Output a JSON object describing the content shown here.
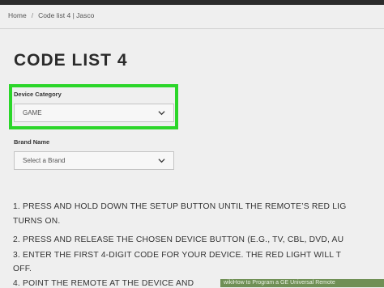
{
  "breadcrumb": {
    "home": "Home",
    "separator": "/",
    "current": "Code list 4 | Jasco"
  },
  "page_title": "CODE LIST 4",
  "device_category": {
    "label": "Device Category",
    "value": "GAME",
    "icon": "chevron-down-icon"
  },
  "brand": {
    "label": "Brand Name",
    "placeholder": "Select a Brand",
    "icon": "chevron-down-icon"
  },
  "steps": [
    "1. PRESS AND HOLD DOWN THE SETUP BUTTON UNTIL THE REMOTE’S RED LIG",
    "TURNS ON.",
    "2. PRESS AND RELEASE THE CHOSEN DEVICE BUTTON (E.G., TV, CBL, DVD, AU",
    "3. ENTER THE FIRST 4-DIGIT CODE FOR YOUR DEVICE. THE RED LIGHT WILL T",
    "OFF.",
    "4. POINT THE REMOTE AT THE DEVICE AND"
  ],
  "footer_banner": "wikiHow to Program a GE Universal Remote",
  "colors": {
    "highlight": "#2bd629",
    "background": "#efefef",
    "topbar": "#2c2c2c"
  }
}
